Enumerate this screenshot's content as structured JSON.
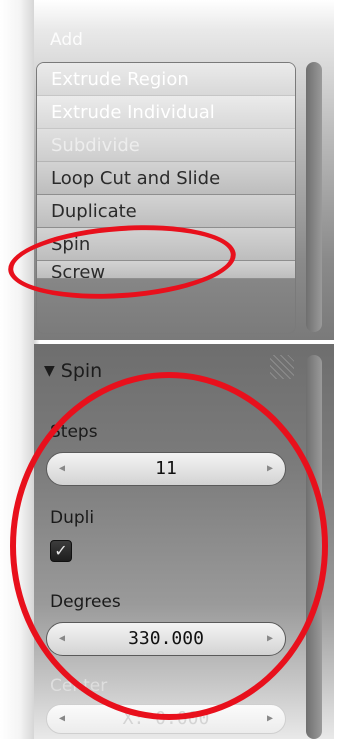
{
  "tool_list": {
    "section_label": "Add",
    "items": [
      {
        "label": "Extrude Region"
      },
      {
        "label": "Extrude Individual"
      },
      {
        "label": "Subdivide"
      },
      {
        "label": "Loop Cut and Slide"
      },
      {
        "label": "Duplicate"
      },
      {
        "label": "Spin"
      },
      {
        "label": "Screw"
      }
    ]
  },
  "operator_panel": {
    "title": "Spin",
    "steps": {
      "label": "Steps",
      "value": "11"
    },
    "dupli": {
      "label": "Dupli",
      "checked": true,
      "check_glyph": "✓"
    },
    "degrees": {
      "label": "Degrees",
      "value": "330.000"
    },
    "center": {
      "label": "Center",
      "value": "X: 0.000"
    }
  },
  "annotations": {
    "ring_color": "#e8101c"
  }
}
